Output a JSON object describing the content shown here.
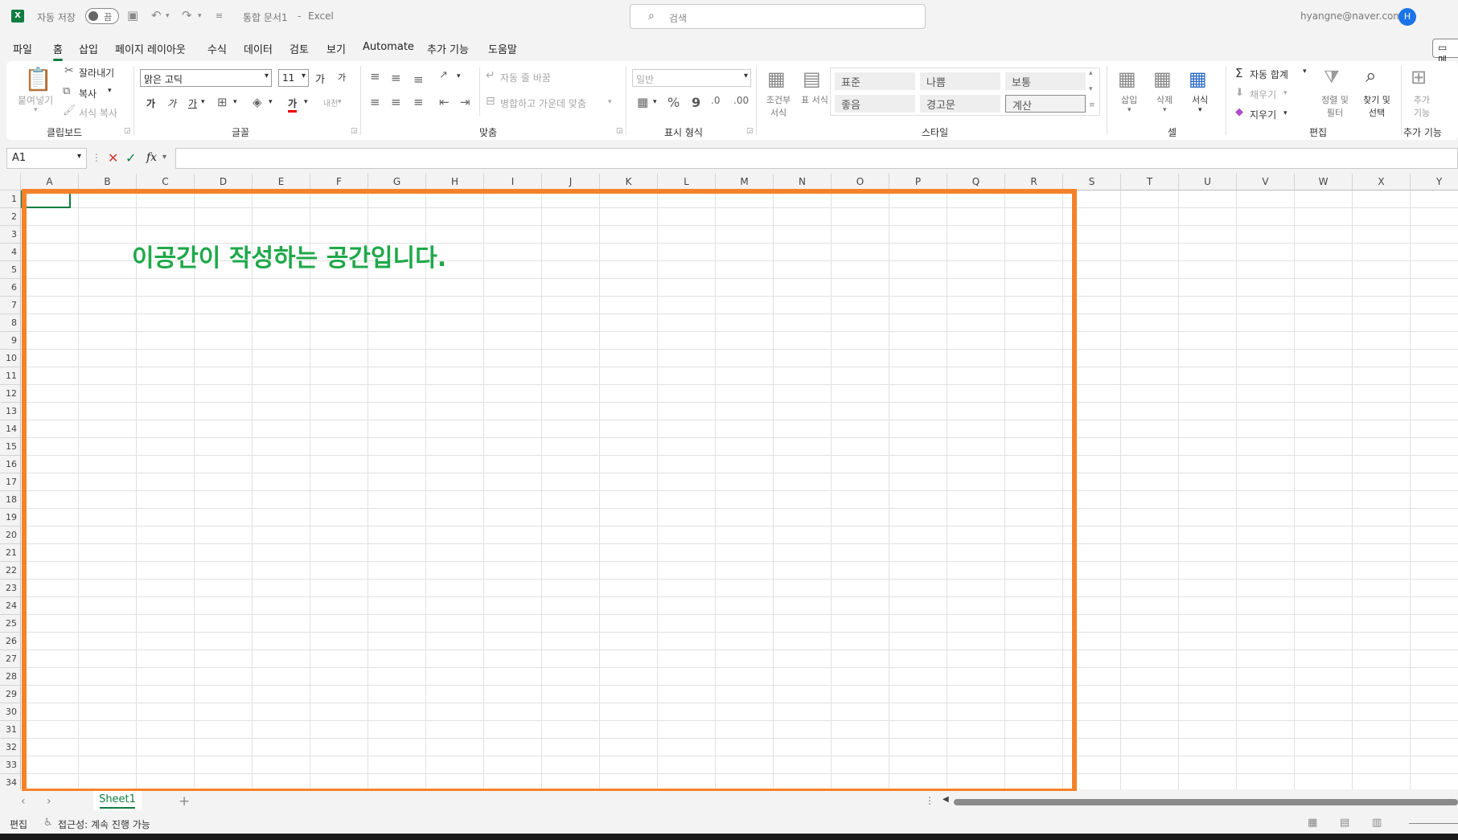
{
  "titlebar": {
    "autosave_label": "자동 저장",
    "autosave_state": "끔",
    "doc_title": "통합 문서1",
    "separator": "-",
    "app_name": "Excel",
    "search_placeholder": "검색",
    "account_email": "hyangne@naver.com",
    "avatar_initial": "H"
  },
  "tabs": [
    "파일",
    "홈",
    "삽입",
    "페이지 레이아웃",
    "수식",
    "데이터",
    "검토",
    "보기",
    "Automate",
    "추가 기능",
    "도움말"
  ],
  "comment_button": "메",
  "ribbon": {
    "clipboard": {
      "paste": "붙여넣기",
      "cut": "잘라내기",
      "copy": "복사",
      "format_painter": "서식 복사",
      "label": "클립보드"
    },
    "font": {
      "name": "맑은 고딕",
      "size": "11",
      "grow": "가",
      "shrink": "가",
      "bold": "가",
      "italic": "가",
      "underline": "가",
      "color": "가",
      "phonetic": "내천",
      "label": "글꼴"
    },
    "alignment": {
      "wrap": "자동 줄 바꿈",
      "merge": "병합하고 가운데 맞춤",
      "label": "맞춤"
    },
    "number": {
      "format": "일반",
      "percent": "%",
      "comma": "9",
      "label": "표시 형식"
    },
    "styles": {
      "conditional": "조건부 서식",
      "table": "표 서식",
      "normal": "표준",
      "bad": "나쁨",
      "neutral": "보통",
      "good": "좋음",
      "warning": "경고문",
      "calc": "계산",
      "label": "스타일"
    },
    "cells": {
      "insert": "삽입",
      "delete": "삭제",
      "format": "서식",
      "label": "셀"
    },
    "editing": {
      "autosum": "자동 합계",
      "fill": "채우기",
      "clear": "지우기",
      "sort": "정렬 및 필터",
      "find": "찾기 및 선택",
      "label": "편집"
    },
    "addins": {
      "button": "추가 기능",
      "label": "추가 기능"
    }
  },
  "formula_bar": {
    "name_box": "A1",
    "fx": "fx",
    "value": ""
  },
  "columns": [
    "A",
    "B",
    "C",
    "D",
    "E",
    "F",
    "G",
    "H",
    "I",
    "J",
    "K",
    "L",
    "M",
    "N",
    "O",
    "P",
    "Q",
    "R",
    "S",
    "T",
    "U",
    "V",
    "W",
    "X",
    "Y"
  ],
  "rows": [
    "1",
    "2",
    "3",
    "4",
    "5",
    "6",
    "7",
    "8",
    "9",
    "10",
    "11",
    "12",
    "13",
    "14",
    "15",
    "16",
    "17",
    "18",
    "19",
    "20",
    "21",
    "22",
    "23",
    "24",
    "25",
    "26",
    "27",
    "28",
    "29",
    "30",
    "31",
    "32",
    "33",
    "34"
  ],
  "annotation_text": "이공간이 작성하는 공간입니다.",
  "annotation_color": "#1fa84a",
  "highlight_color": "#f5822a",
  "sheets": [
    "Sheet1"
  ],
  "statusbar": {
    "mode": "편집",
    "accessibility": "접근성: 계속 진행 가능"
  }
}
